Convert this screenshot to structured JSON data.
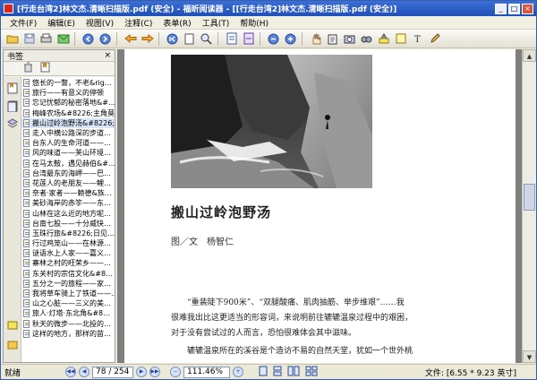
{
  "window": {
    "title": "[行走台湾2]林文杰.清晰扫描版.pdf (安全) - 福昕阅读器 - [[行走台湾2]林文杰.清晰扫描版.pdf (安全)]",
    "controls": {
      "minimize": "_",
      "maximize": "□",
      "close": "×"
    }
  },
  "menu": [
    "文件(F)",
    "编辑(E)",
    "视图(V)",
    "注释(C)",
    "表单(R)",
    "工具(T)",
    "帮助(H)"
  ],
  "toolbar_icons": [
    "open-icon",
    "save-icon",
    "print-icon",
    "email-icon",
    "prev-icon",
    "next-icon",
    "back-icon",
    "forward-icon",
    "first-page-icon",
    "page-icon",
    "zoom-in-icon",
    "fit-page-icon",
    "fit-width-icon",
    "zoom-out-icon",
    "zoom-in-plus-icon",
    "hand-tool-icon",
    "select-tool-icon",
    "snapshot-icon",
    "find-icon",
    "highlight-icon",
    "note-icon",
    "text-icon",
    "pencil-icon"
  ],
  "sidebar": {
    "title": "书签",
    "close": "×",
    "bookmarks": [
      "悠长的一瞥，不老&rig…",
      "旅行——有意义的停顿",
      "忘记忧郁的秘密落地&#…",
      "梅峰农场&#8226;主角莫…",
      "搬山过岭泡野汤&#8226;…",
      "走入中横公路深的步道…",
      "台东人的生命河道——…",
      "风的味道——芙山环境…",
      "在马太鞍，遇见赫伯&#…",
      "台湾最东的海岬——巴…",
      "花莲人的老朋友——鲤…",
      "奈者·家者——赖德&族…",
      "美砂海岸的赤竽——东…",
      "山林在这么近的地方呢…",
      "台南七股——十分威快…",
      "玉珠行旅&#8226;日见…",
      "行过鸡笼山——在林源…",
      "谜语水上人家——嘉义…",
      "寨林之村的旺荣乡——…",
      "东关村的宗信文化&#8…",
      "五分之一的旅程——家…",
      "我将草车骑上了铁道——…",
      "山之心脏——三义的美…",
      "旅人·灯塔·东北角&#8…",
      "秋天的微步——北投的…",
      "这样的地方，那样的苗…"
    ],
    "selected_index": 4
  },
  "document": {
    "article_title": "搬山过岭泡野汤",
    "byline": "图／文　杨智仁",
    "paragraph_lines": [
      "“重装陡下900米”、“双腿酸痛、肌肉抽筋、举步维艰”……我",
      "很难我出比这更适当的形容词，来说明前往辘辘温泉过程中的艰困，",
      "对于没有尝试过的人而言，恐怕很难体会其中滋味。",
      "辘辘温泉所在的溪谷是个造访不易的自然天堂，犹如一个世外桃"
    ]
  },
  "statusbar": {
    "ready": "就绪",
    "page_indicator": "78 / 254",
    "zoom": "111.46%",
    "page_size": "文件: [6.55 * 9.23 英寸]"
  }
}
